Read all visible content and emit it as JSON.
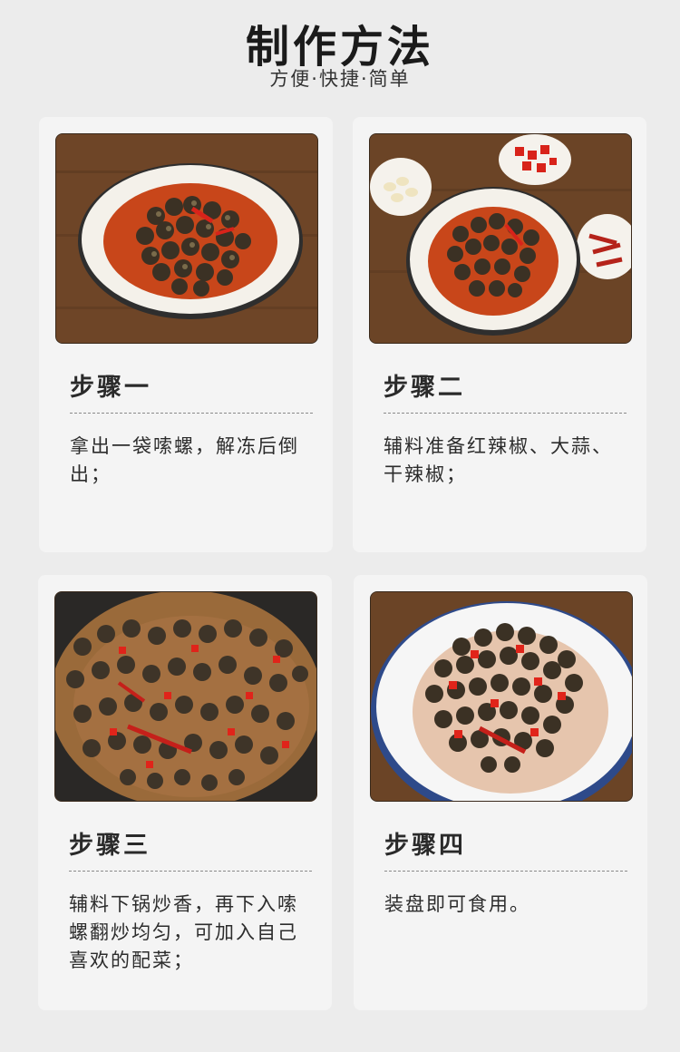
{
  "header": {
    "title": "制作方法",
    "subtitle": "方便·快捷·简单"
  },
  "steps": [
    {
      "title": "步骤一",
      "desc": "拿出一袋嗦螺，解冻后倒出；",
      "image": "snails-in-bowl-photo"
    },
    {
      "title": "步骤二",
      "desc": "辅料准备红辣椒、大蒜、干辣椒；",
      "image": "ingredients-photo"
    },
    {
      "title": "步骤三",
      "desc": "辅料下锅炒香，再下入嗦螺翻炒均匀，可加入自己喜欢的配菜；",
      "image": "stir-fry-wok-photo"
    },
    {
      "title": "步骤四",
      "desc": "装盘即可食用。",
      "image": "plated-dish-photo"
    }
  ],
  "colors": {
    "background": "#ececec",
    "card": "#f4f4f4",
    "wood": "#6b4426",
    "sauce": "#c8461a",
    "chili": "#d8231a",
    "snail": "#3b3124"
  }
}
